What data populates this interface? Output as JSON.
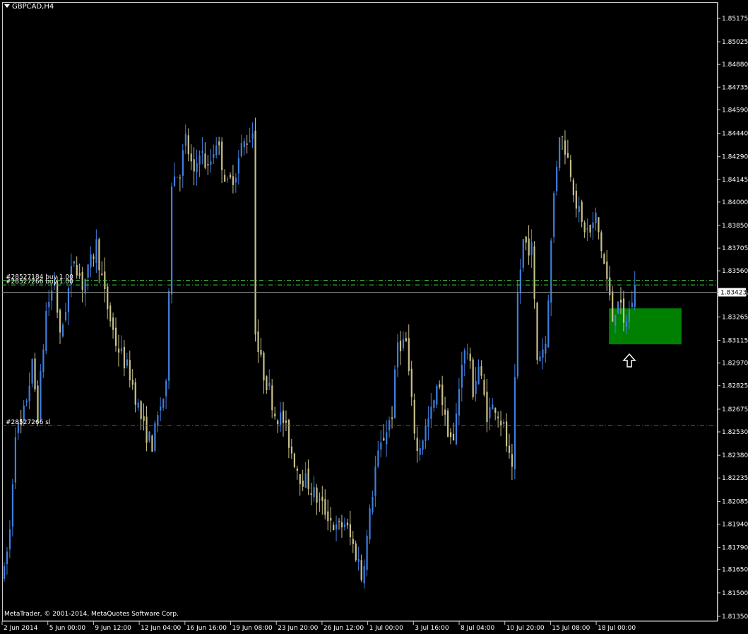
{
  "window": {
    "title": "GBPCAD,H4"
  },
  "copyright": "MetaTrader, © 2001-2014, MetaQuotes Software Corp.",
  "colors": {
    "background": "#000000",
    "bull": "#3f7fe0",
    "bear": "#c8c08a",
    "entry_line": "#44cc44",
    "sl_line": "#ee2222",
    "bid_line": "#8c8c8c",
    "zone": "#008000",
    "arrow": "#ffffff"
  },
  "chart_data": {
    "type": "candlestick",
    "symbol": "GBPCAD",
    "timeframe": "H4",
    "ylim": [
      1.8135,
      1.8522
    ],
    "y_ticks": [
      "1.85175",
      "1.85025",
      "1.84880",
      "1.84735",
      "1.84590",
      "1.84440",
      "1.84290",
      "1.84145",
      "1.84000",
      "1.83850",
      "1.83705",
      "1.83560",
      "1.83415",
      "1.83265",
      "1.83115",
      "1.82970",
      "1.82825",
      "1.82675",
      "1.82530",
      "1.82380",
      "1.82235",
      "1.82085",
      "1.81940",
      "1.81790",
      "1.81650",
      "1.81500",
      "1.81350"
    ],
    "x_ticks": [
      "2 Jun 2014",
      "5 Jun 00:00",
      "9 Jun 12:00",
      "12 Jun 04:00",
      "16 Jun 16:00",
      "19 Jun 08:00",
      "23 Jun 20:00",
      "26 Jun 12:00",
      "1 Jul 00:00",
      "3 Jul 16:00",
      "8 Jul 04:00",
      "10 Jul 20:00",
      "15 Jul 08:00",
      "18 Jul 00:00"
    ],
    "current_price": "1.83423",
    "orders": [
      {
        "label": "#28527184 buy 1.00",
        "price": 1.835
      },
      {
        "label": "#28527266 buy 1.00",
        "price": 1.8347
      },
      {
        "label": "#28527266 sl",
        "price": 1.8257
      }
    ],
    "anchors": [
      [
        0,
        1.8162
      ],
      [
        2,
        1.819
      ],
      [
        4,
        1.8255
      ],
      [
        6,
        1.8255
      ],
      [
        10,
        1.8295
      ],
      [
        12,
        1.8265
      ],
      [
        15,
        1.833
      ],
      [
        18,
        1.835
      ],
      [
        20,
        1.8312
      ],
      [
        25,
        1.8365
      ],
      [
        28,
        1.8347
      ],
      [
        30,
        1.8355
      ],
      [
        33,
        1.8373
      ],
      [
        36,
        1.834
      ],
      [
        40,
        1.831
      ],
      [
        45,
        1.829
      ],
      [
        50,
        1.8255
      ],
      [
        53,
        1.8245
      ],
      [
        56,
        1.827
      ],
      [
        58,
        1.828
      ],
      [
        60,
        1.8415
      ],
      [
        63,
        1.842
      ],
      [
        65,
        1.844
      ],
      [
        68,
        1.8415
      ],
      [
        70,
        1.8435
      ],
      [
        73,
        1.842
      ],
      [
        76,
        1.844
      ],
      [
        78,
        1.8425
      ],
      [
        80,
        1.841
      ],
      [
        83,
        1.842
      ],
      [
        85,
        1.8435
      ],
      [
        87,
        1.844
      ],
      [
        89,
        1.8445
      ],
      [
        90,
        1.832
      ],
      [
        91,
        1.8305
      ],
      [
        93,
        1.829
      ],
      [
        95,
        1.828
      ],
      [
        97,
        1.8265
      ],
      [
        100,
        1.826
      ],
      [
        103,
        1.824
      ],
      [
        106,
        1.8225
      ],
      [
        109,
        1.822
      ],
      [
        112,
        1.821
      ],
      [
        116,
        1.82
      ],
      [
        119,
        1.819
      ],
      [
        122,
        1.8195
      ],
      [
        125,
        1.818
      ],
      [
        127,
        1.817
      ],
      [
        128,
        1.816
      ],
      [
        130,
        1.8185
      ],
      [
        133,
        1.823
      ],
      [
        136,
        1.825
      ],
      [
        139,
        1.8265
      ],
      [
        141,
        1.831
      ],
      [
        144,
        1.831
      ],
      [
        146,
        1.827
      ],
      [
        148,
        1.824
      ],
      [
        150,
        1.825
      ],
      [
        153,
        1.8265
      ],
      [
        156,
        1.8285
      ],
      [
        158,
        1.826
      ],
      [
        161,
        1.8245
      ],
      [
        164,
        1.83
      ],
      [
        166,
        1.8305
      ],
      [
        168,
        1.828
      ],
      [
        170,
        1.8295
      ],
      [
        173,
        1.8265
      ],
      [
        176,
        1.827
      ],
      [
        179,
        1.8255
      ],
      [
        182,
        1.8225
      ],
      [
        184,
        1.834
      ],
      [
        186,
        1.8375
      ],
      [
        189,
        1.837
      ],
      [
        191,
        1.83
      ],
      [
        194,
        1.831
      ],
      [
        197,
        1.8405
      ],
      [
        199,
        1.8445
      ],
      [
        201,
        1.8435
      ],
      [
        203,
        1.842
      ],
      [
        205,
        1.84
      ],
      [
        207,
        1.8385
      ],
      [
        210,
        1.838
      ],
      [
        212,
        1.839
      ],
      [
        214,
        1.837
      ],
      [
        216,
        1.835
      ],
      [
        218,
        1.8325
      ],
      [
        220,
        1.834
      ],
      [
        222,
        1.832
      ],
      [
        224,
        1.833
      ],
      [
        226,
        1.8345
      ]
    ],
    "zone": {
      "x_from_idx": 217,
      "x_to_idx": 243,
      "price_high": 1.8332,
      "price_low": 1.8309
    },
    "grid": false,
    "legend": "none"
  }
}
